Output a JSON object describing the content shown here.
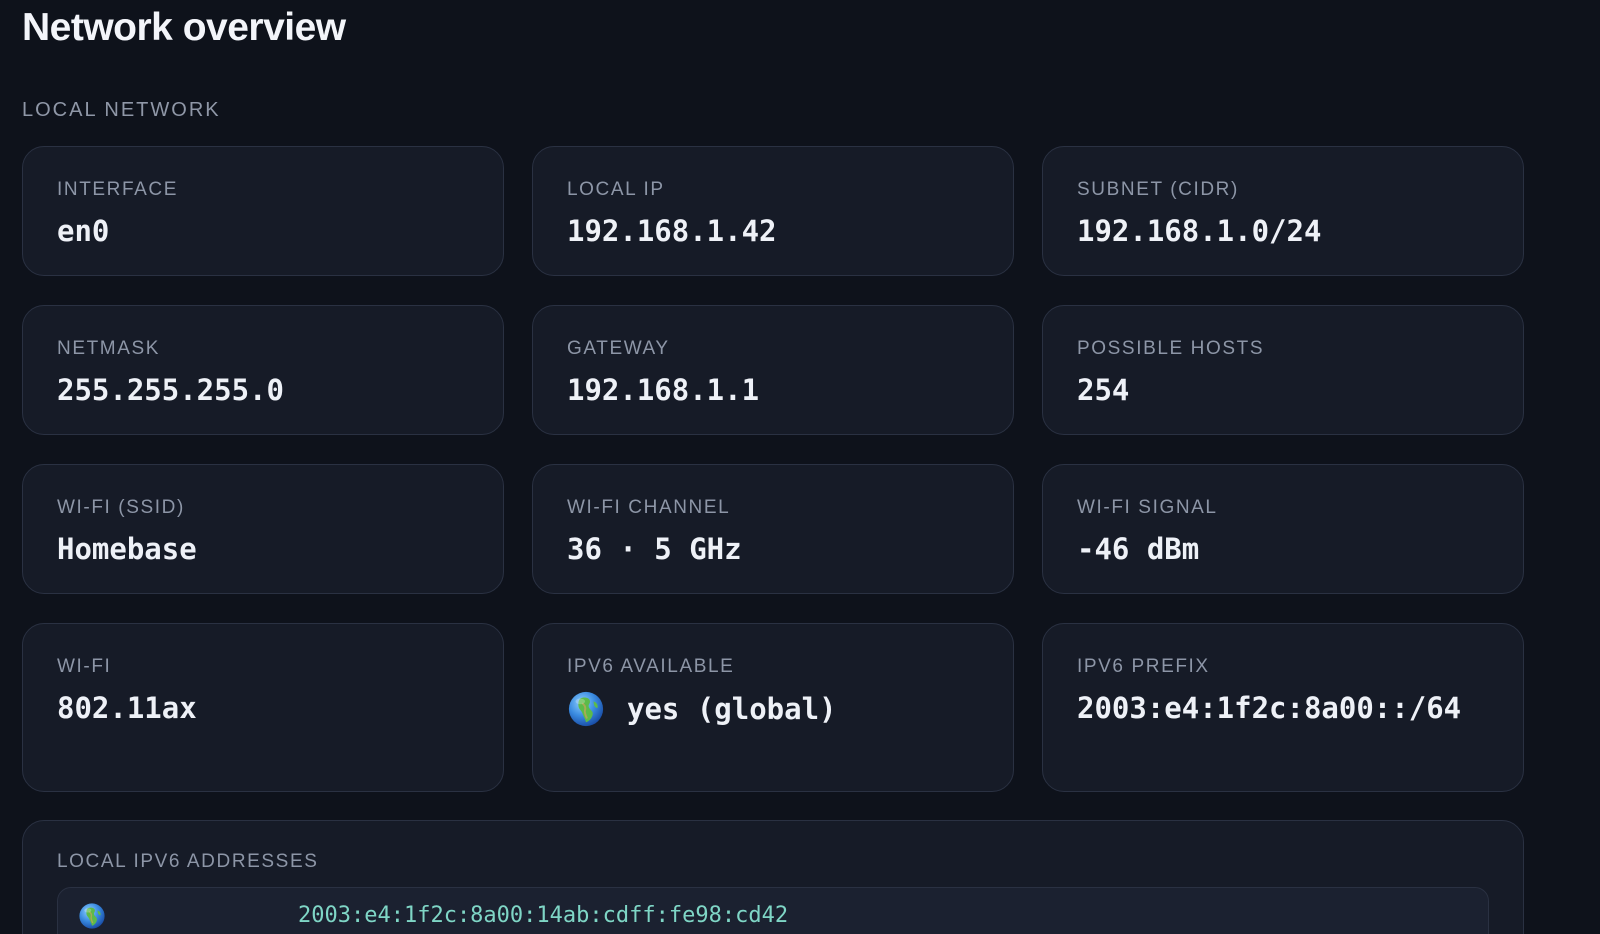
{
  "page": {
    "title": "Network overview"
  },
  "sections": {
    "local_network": "LOCAL NETWORK"
  },
  "cards": [
    {
      "label": "INTERFACE",
      "value": "en0"
    },
    {
      "label": "LOCAL IP",
      "value": "192.168.1.42"
    },
    {
      "label": "SUBNET (CIDR)",
      "value": "192.168.1.0/24"
    },
    {
      "label": "NETMASK",
      "value": "255.255.255.0"
    },
    {
      "label": "GATEWAY",
      "value": "192.168.1.1"
    },
    {
      "label": "POSSIBLE HOSTS",
      "value": "254"
    },
    {
      "label": "WI-FI (SSID)",
      "value": "Homebase"
    },
    {
      "label": "WI-FI CHANNEL",
      "value": "36 · 5 GHz"
    },
    {
      "label": "WI-FI SIGNAL",
      "value": "-46 dBm"
    },
    {
      "label": "WI-FI",
      "value": "802.11ax"
    },
    {
      "label": "IPV6 AVAILABLE",
      "value": "yes (global)",
      "icon": "globe-icon"
    },
    {
      "label": "IPV6 PREFIX",
      "value": "2003:e4:1f2c:8a00::/64"
    }
  ],
  "ipv6_addresses": {
    "label": "LOCAL IPV6 ADDRESSES",
    "items": [
      {
        "icon": "globe-icon",
        "address": "2003:e4:1f2c:8a00:14ab:cdff:fe98:cd42"
      }
    ]
  },
  "colors": {
    "background": "#0e121b",
    "card": "#161b27",
    "border": "#2a3142",
    "label": "#8d96a7",
    "value": "#eef1f7",
    "address": "#7fd6c6"
  }
}
